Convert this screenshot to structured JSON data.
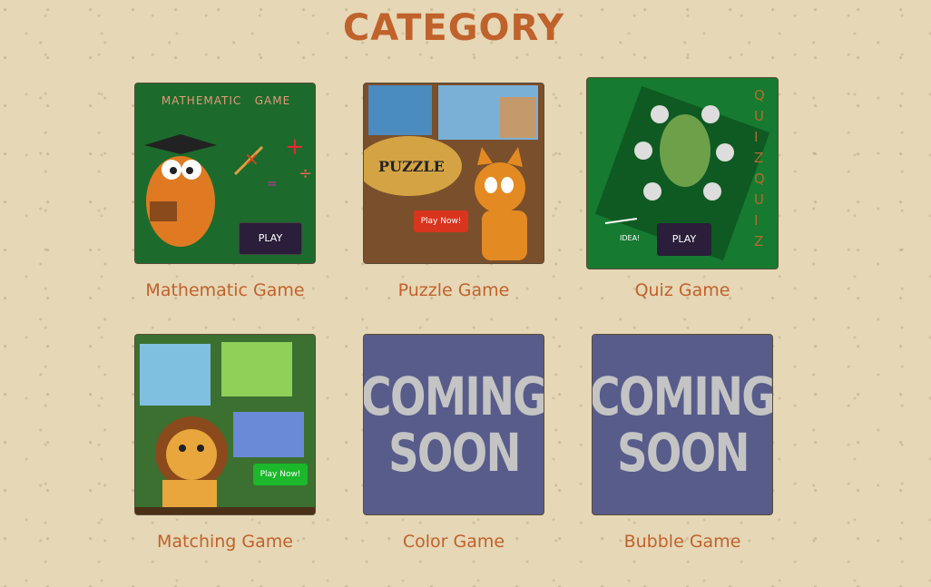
{
  "page": {
    "title": "CATEGORY"
  },
  "games": [
    {
      "label": "Mathematic Game",
      "thumb_title": "MATHEMATIC   GAME",
      "play_label": "PLAY"
    },
    {
      "label": "Puzzle Game",
      "thumb_title": "PUZZLE",
      "play_label": "Play Now!"
    },
    {
      "label": "Quiz Game",
      "thumb_title": "QUIZQUIZ",
      "idea_label": "IDEA!",
      "play_label": "PLAY"
    },
    {
      "label": "Matching Game",
      "play_label": "Play Now!"
    },
    {
      "label": "Color Game",
      "soon_line1": "COMING",
      "soon_line2": "SOON"
    },
    {
      "label": "Bubble Game",
      "soon_line1": "COMING",
      "soon_line2": "SOON"
    }
  ],
  "colors": {
    "accent": "#c0622b",
    "background": "#e6d7b6",
    "coming_soon_bg": "#585c8a"
  }
}
